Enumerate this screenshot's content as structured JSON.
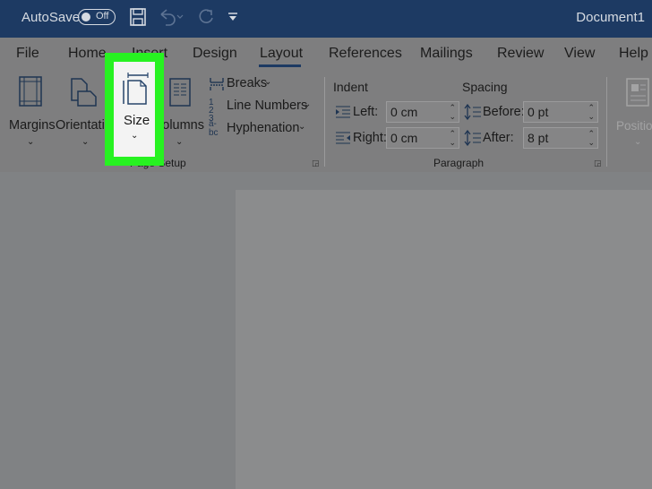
{
  "titlebar": {
    "autosave_label": "AutoSave",
    "autosave_state": "Off",
    "doc_title": "Document1",
    "icons": [
      "save-icon",
      "undo-icon",
      "redo-icon",
      "customize-qat-icon"
    ]
  },
  "tabs": [
    "File",
    "Home",
    "Insert",
    "Design",
    "Layout",
    "References",
    "Mailings",
    "Review",
    "View",
    "Help"
  ],
  "active_tab": "Layout",
  "page_setup": {
    "margins": "Margins",
    "orientation": "Orientation",
    "size": "Size",
    "columns": "Columns",
    "breaks": "Breaks",
    "line_numbers": "Line Numbers",
    "hyphenation": "Hyphenation",
    "group_label": "Page Setup"
  },
  "paragraph": {
    "indent_header": "Indent",
    "spacing_header": "Spacing",
    "left_label": "Left:",
    "left_value": "0 cm",
    "right_label": "Right:",
    "right_value": "0 cm",
    "before_label": "Before:",
    "before_value": "0 pt",
    "after_label": "After:",
    "after_value": "8 pt",
    "group_label": "Paragraph"
  },
  "arrange": {
    "position": "Position"
  },
  "colors": {
    "titlebar": "#1d3a63",
    "highlight": "#27f221",
    "ribbon": "#7e7e7f"
  }
}
